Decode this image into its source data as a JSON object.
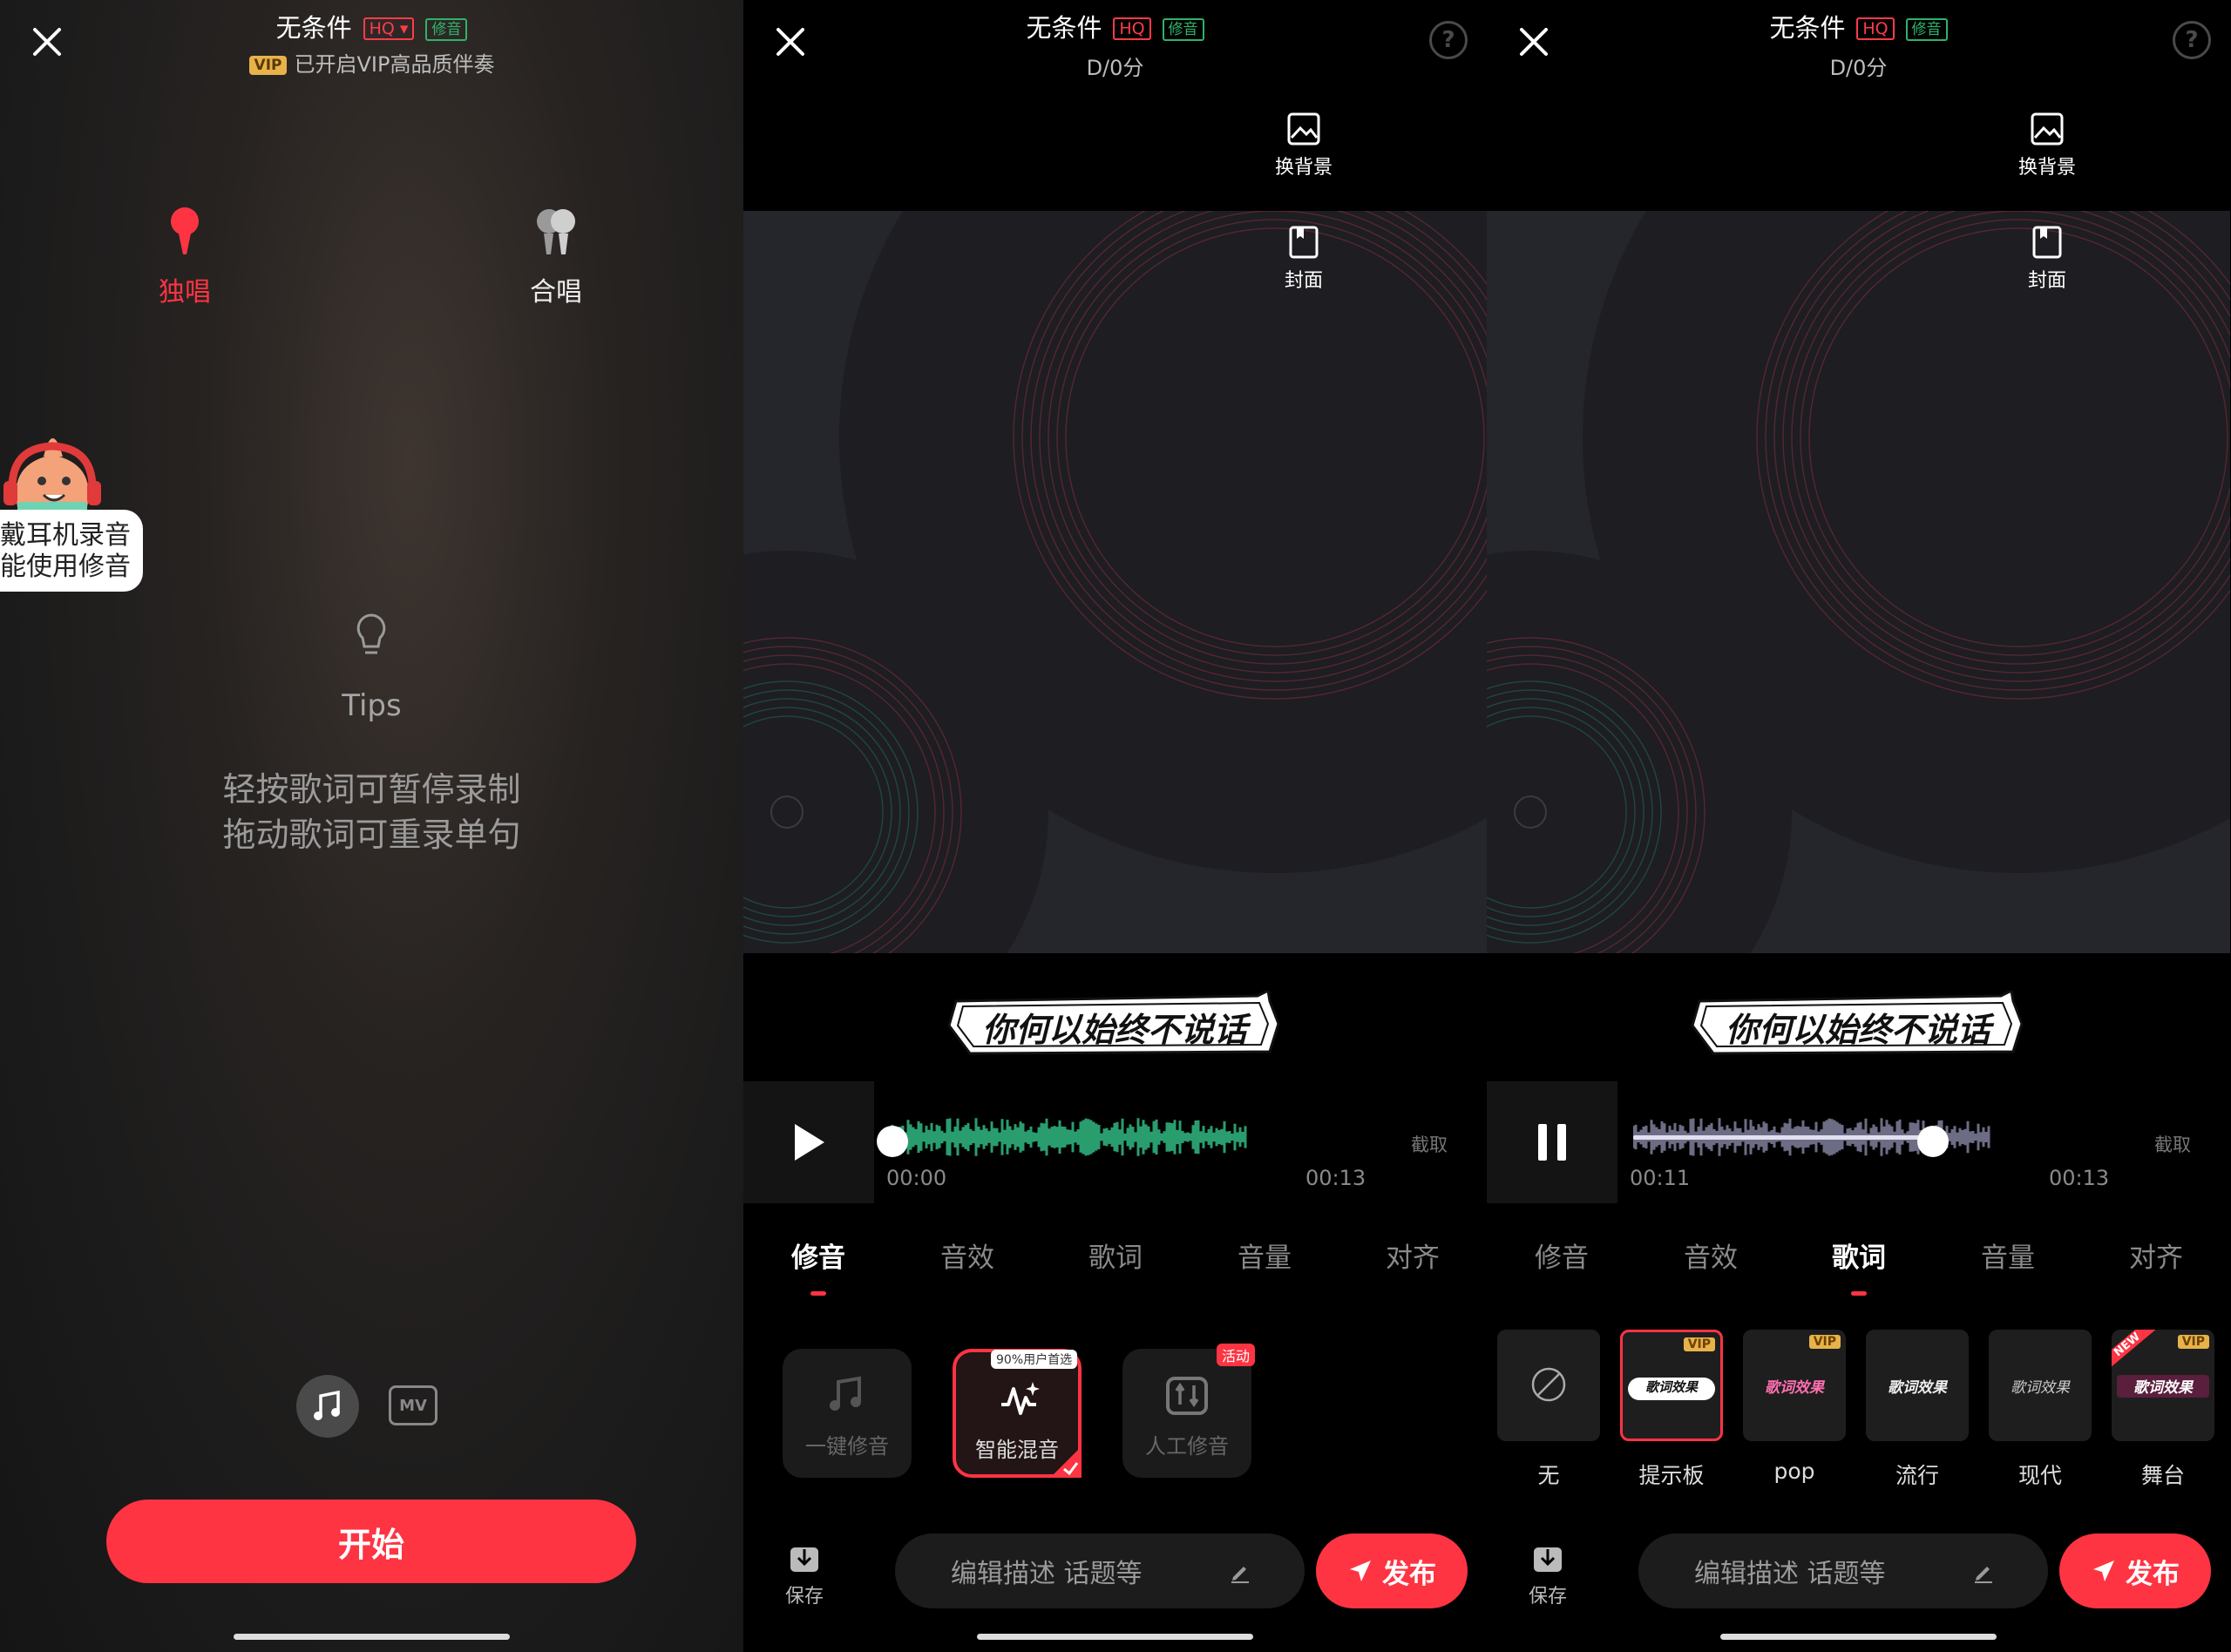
{
  "song": {
    "title": "无条件",
    "hq": "HQ",
    "xiuyin": "修音"
  },
  "panel1": {
    "vip_chip": "VIP",
    "vip_line": "已开启VIP高品质伴奏",
    "solo_label": "独唱",
    "chorus_label": "合唱",
    "headphone_tip_line1": "戴耳机录音",
    "headphone_tip_line2": "能使用修音",
    "tips_title": "Tips",
    "tips_line1": "轻按歌词可暂停录制",
    "tips_line2": "拖动歌词可重录单句",
    "mv_label": "MV",
    "start_button": "开始"
  },
  "editor": {
    "score": "D/0分",
    "change_bg": "换背景",
    "cover": "封面",
    "lyric_line": "你何以始终不说话",
    "cut_label": "截取",
    "help": "?",
    "tabs": [
      "修音",
      "音效",
      "歌词",
      "音量",
      "对齐"
    ],
    "save_label": "保存",
    "desc_placeholder": "编辑描述 话题等",
    "publish_label": "发布"
  },
  "panel2": {
    "time_start": "00:00",
    "time_end": "00:13",
    "progress": 0.0,
    "active_tab": "修音",
    "tools": [
      {
        "label": "一键修音",
        "badge": ""
      },
      {
        "label": "智能混音",
        "badge": "90%用户首选"
      },
      {
        "label": "人工修音",
        "badge": "活动"
      }
    ]
  },
  "panel3": {
    "time_start": "00:11",
    "time_end": "00:13",
    "progress": 0.84,
    "active_tab": "歌词",
    "effect_art_text": "歌词效果",
    "effects": [
      {
        "label": "无",
        "vip": ""
      },
      {
        "label": "提示板",
        "vip": "VIP"
      },
      {
        "label": "pop",
        "vip": "VIP"
      },
      {
        "label": "流行",
        "vip": ""
      },
      {
        "label": "现代",
        "vip": ""
      },
      {
        "label": "舞台",
        "vip": "VIP",
        "new": "NEW"
      }
    ]
  },
  "colors": {
    "accent": "#fe3443",
    "green_wave": "#2a9d6f",
    "vip_gold": "#e8b24a"
  }
}
